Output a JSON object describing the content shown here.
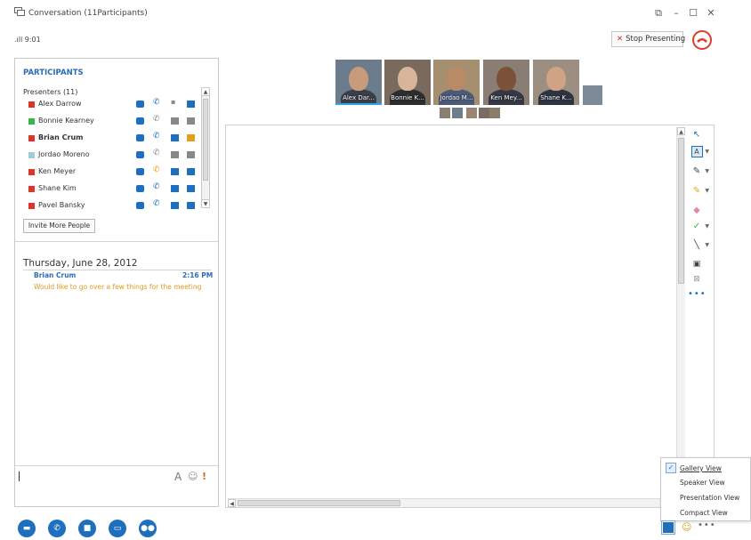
{
  "window": {
    "title": "Conversation (11Participants)",
    "controls": [
      "restore-down",
      "minimize",
      "maximize",
      "close"
    ]
  },
  "status": {
    "signal": "9:01"
  },
  "header": {
    "stop_presenting_label": "Stop Presenting",
    "hangup_icon": "hangup-icon"
  },
  "participants_panel": {
    "title": "PARTICIPANTS",
    "presenters_header": "Presenters (11)",
    "presenters": [
      {
        "name": "Alex Darrow",
        "color": "#d9352a",
        "bold": false
      },
      {
        "name": "Bonnie Kearney",
        "color": "#39b54a",
        "bold": false
      },
      {
        "name": "Brian Crum",
        "color": "#d9352a",
        "bold": true
      },
      {
        "name": "Jordao Moreno",
        "color": "#a8c8d8",
        "bold": false
      },
      {
        "name": "Ken Meyer",
        "color": "#d9352a",
        "bold": false
      },
      {
        "name": "Shane Kim",
        "color": "#d9352a",
        "bold": false
      },
      {
        "name": "Pavel Bansky",
        "color": "#d9352a",
        "bold": false
      }
    ],
    "invite_label": "Invite More People"
  },
  "conversation": {
    "date": "Thursday, June 28, 2012",
    "messages": [
      {
        "sender": "Brian Crum",
        "time": "2:16 PM",
        "text": "Would like to go over a few things for the meeting"
      }
    ],
    "compose_icons": [
      "font-icon",
      "emoticon-icon",
      "importance-icon"
    ]
  },
  "gallery": {
    "tiles": [
      {
        "label": "Alex Dar...",
        "active": true
      },
      {
        "label": "Bonnie K...",
        "active": false
      },
      {
        "label": "Jordao M...",
        "active": false
      },
      {
        "label": "Ken Mey...",
        "active": false
      },
      {
        "label": "Shane K...",
        "active": false
      }
    ]
  },
  "view_menu": {
    "items": [
      {
        "label": "Gallery View",
        "checked": true
      },
      {
        "label": "Speaker View",
        "checked": false
      },
      {
        "label": "Presentation View",
        "checked": false
      },
      {
        "label": "Compact View",
        "checked": false
      }
    ]
  },
  "bottom_toolbar": {
    "buttons": [
      "im-icon",
      "call-icon",
      "video-icon",
      "present-icon",
      "participants-icon"
    ]
  },
  "whiteboard_tools": [
    "select-icon",
    "text-icon",
    "pen-icon",
    "highlighter-icon",
    "eraser-icon",
    "stamp-icon",
    "line-icon",
    "insert-image-icon",
    "delete-icon",
    "more-icon"
  ],
  "colors": {
    "accent": "#1e6fbe",
    "link": "#2b6cb8",
    "alert": "#d9352a",
    "message": "#e09a1e"
  }
}
